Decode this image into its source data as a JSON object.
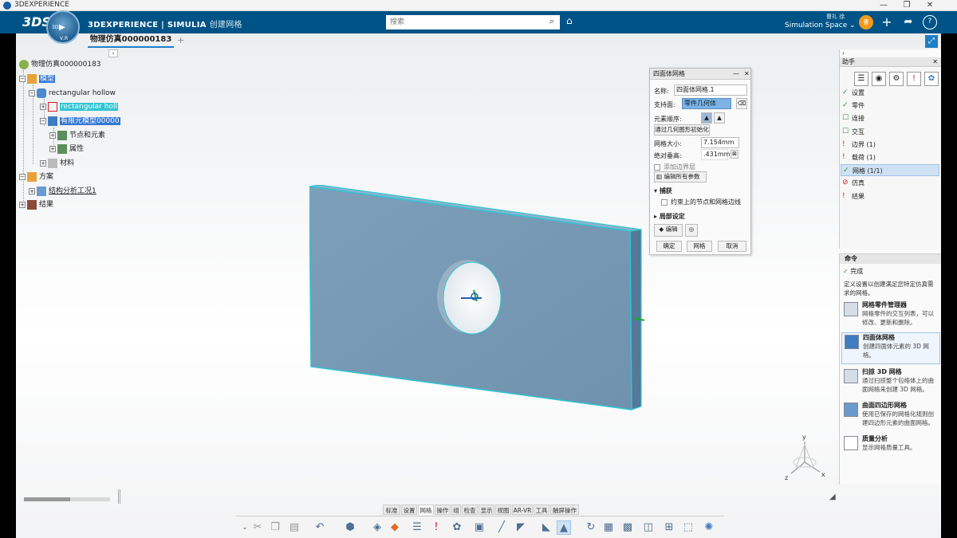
{
  "window": {
    "title": "3DEXPERIENCE",
    "controls": [
      "—",
      "❐",
      "✕"
    ]
  },
  "header": {
    "logo": "3DS",
    "brand": "3DEXPERIENCE | SIMULIA",
    "app_name": "创建网格",
    "compass_labels": [
      "3D",
      "V,R"
    ],
    "search_placeholder": "搜索",
    "user": "曹礼 徐",
    "space": "Simulation Space",
    "icons": [
      "search-icon",
      "tag-icon",
      "plus-icon",
      "share-icon",
      "help-icon"
    ]
  },
  "tabs": {
    "active": "物理仿真000000183",
    "plus": "+"
  },
  "tree": {
    "root": "物理仿真000000183",
    "model": "模型",
    "part": "rectangular hollow",
    "part_child": "rectangular holl",
    "fem": "有限元模型00000",
    "nodes": "节点和元素",
    "props": "属性",
    "material": "材料",
    "scenario": "方案",
    "case": "结构分析工况1",
    "results": "结果"
  },
  "dialog": {
    "title": "四面体网格",
    "name_label": "名称:",
    "name_value": "四面体网格.1",
    "support_label": "支持面:",
    "support_value": "零件几何体",
    "order_label": "元素顺序:",
    "init_btn": "通过几何图形初始化",
    "size_label": "网格大小:",
    "size_value": "7.154mm",
    "sag_label": "绝对垂高:",
    "sag_value": ".431mm",
    "boundary_label": "添加边界层",
    "edit_all": "编辑所有参数",
    "capture": "捕获",
    "constraint": "约束上的节点和网格边线",
    "local": "局部设定",
    "edit": "编辑",
    "ok": "确定",
    "mesh": "网格",
    "cancel": "取消"
  },
  "assistant": {
    "title": "助手",
    "items": [
      {
        "mark": "✓",
        "label": "设置",
        "color": "#2e8b3a"
      },
      {
        "mark": "✓",
        "label": "零件",
        "color": "#2e8b3a"
      },
      {
        "mark": "☐",
        "label": "连接",
        "color": "#2e8b3a"
      },
      {
        "mark": "☐",
        "label": "交互",
        "color": "#2e8b3a"
      },
      {
        "mark": "!",
        "label": "边界 (1)",
        "color": "#d0202a"
      },
      {
        "mark": "!",
        "label": "载荷 (1)",
        "color": "#d0202a"
      },
      {
        "mark": "✓",
        "label": "网格 (1/1)",
        "color": "#2e8b3a"
      },
      {
        "mark": "⊘",
        "label": "仿真",
        "color": "#d0202a"
      },
      {
        "mark": "!",
        "label": "结果",
        "color": "#d0202a"
      }
    ]
  },
  "commands": {
    "title": "命令",
    "done": "完成",
    "intro": "定义设置以创建满足您特定仿真需求的网格。",
    "items": [
      {
        "name": "网格零件管理器",
        "desc": "网格零件的交互列表，可以修改、更新和删除。"
      },
      {
        "name": "四面体网格",
        "desc": "创建四面体元素的 3D 网格。"
      },
      {
        "name": "扫掠 3D 网格",
        "desc": "通过扫掠整个包络体上的曲面网格来创建 3D 网格。"
      },
      {
        "name": "曲面四边形网格",
        "desc": "使用已保存的网格化规则创建四边形元素的曲面网格。"
      },
      {
        "name": "质量分析",
        "desc": "显示网格质量工具。"
      }
    ]
  },
  "toolbar": {
    "tabs": [
      "标准",
      "设置",
      "网格",
      "操作",
      "组",
      "检查",
      "显示",
      "视图",
      "AR-VR",
      "工具",
      "触屏操作"
    ],
    "active_tab": "网格"
  },
  "compass": {
    "x": "x",
    "y": "y",
    "z": "z"
  },
  "colors": {
    "header": "#005386",
    "accent": "#1e7fc8",
    "plate": "#7a9cb8",
    "selection": "#2fc5d3"
  }
}
